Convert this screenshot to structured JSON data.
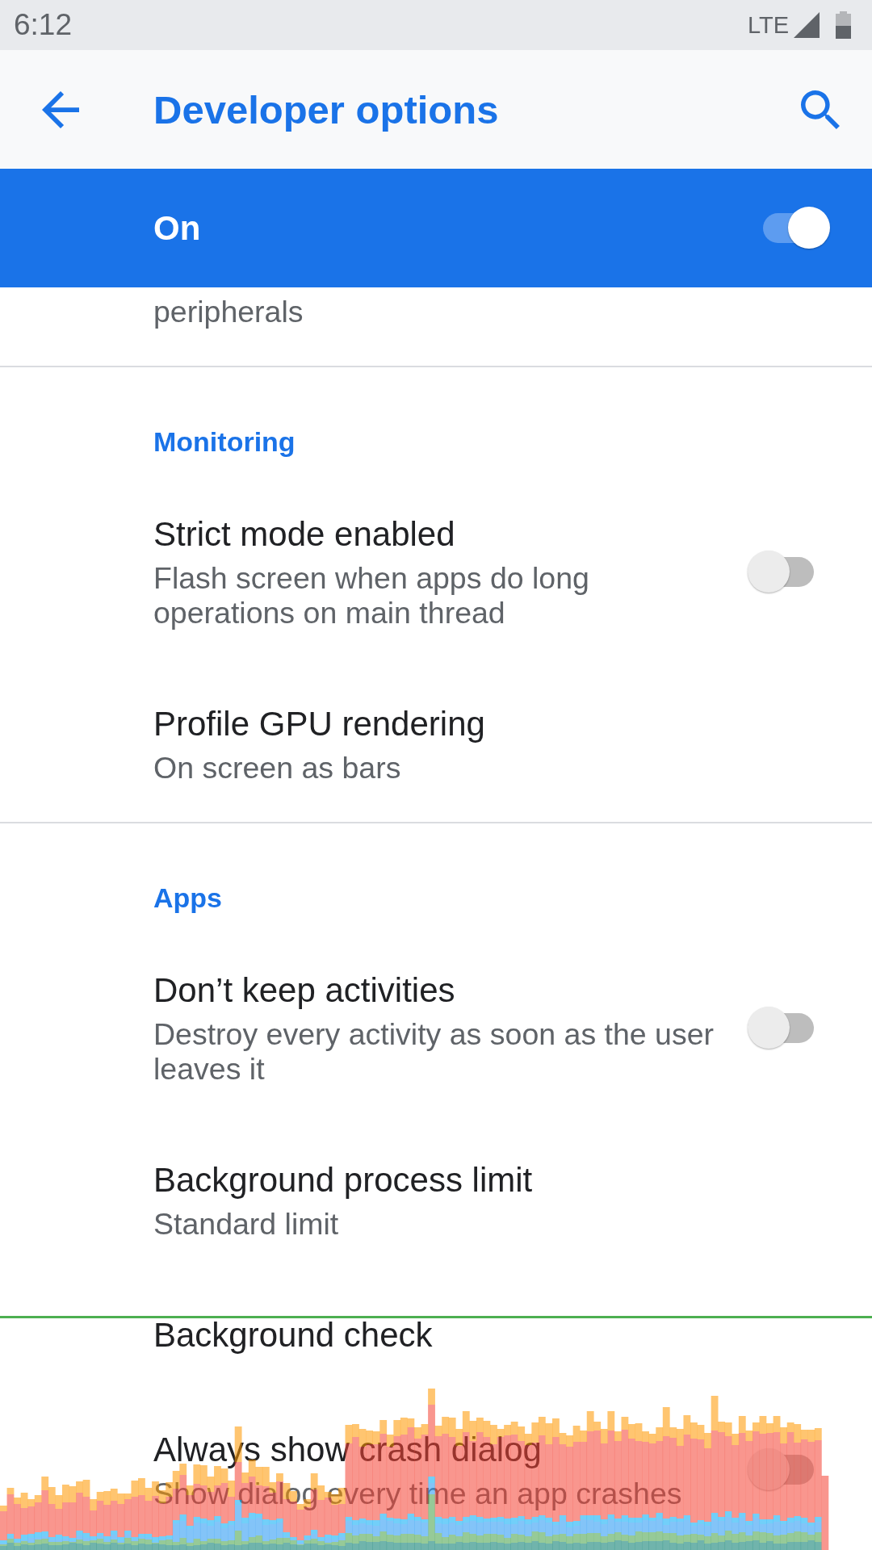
{
  "status_bar": {
    "time": "6:12",
    "network": "LTE"
  },
  "app_bar": {
    "title": "Developer options"
  },
  "master_switch": {
    "label": "On",
    "checked": true
  },
  "sections": [
    {
      "items": [
        {
          "kind": "plain",
          "summary": "peripherals"
        }
      ]
    },
    {
      "header": "Monitoring",
      "items": [
        {
          "kind": "switch",
          "title": "Strict mode enabled",
          "summary": "Flash screen when apps do long operations on main thread",
          "checked": false
        },
        {
          "kind": "plain",
          "title": "Profile GPU rendering",
          "summary": "On screen as bars"
        }
      ]
    },
    {
      "header": "Apps",
      "items": [
        {
          "kind": "switch",
          "title": "Don’t keep activities",
          "summary": "Destroy every activity as soon as the user leaves it",
          "checked": false
        },
        {
          "kind": "plain",
          "title": "Background process limit",
          "summary": "Standard limit"
        },
        {
          "kind": "plain",
          "title": "Background check"
        },
        {
          "kind": "switch",
          "title": "Always show crash dialog",
          "summary": "Show dialog every time an app crashes",
          "checked": false
        }
      ]
    }
  ]
}
